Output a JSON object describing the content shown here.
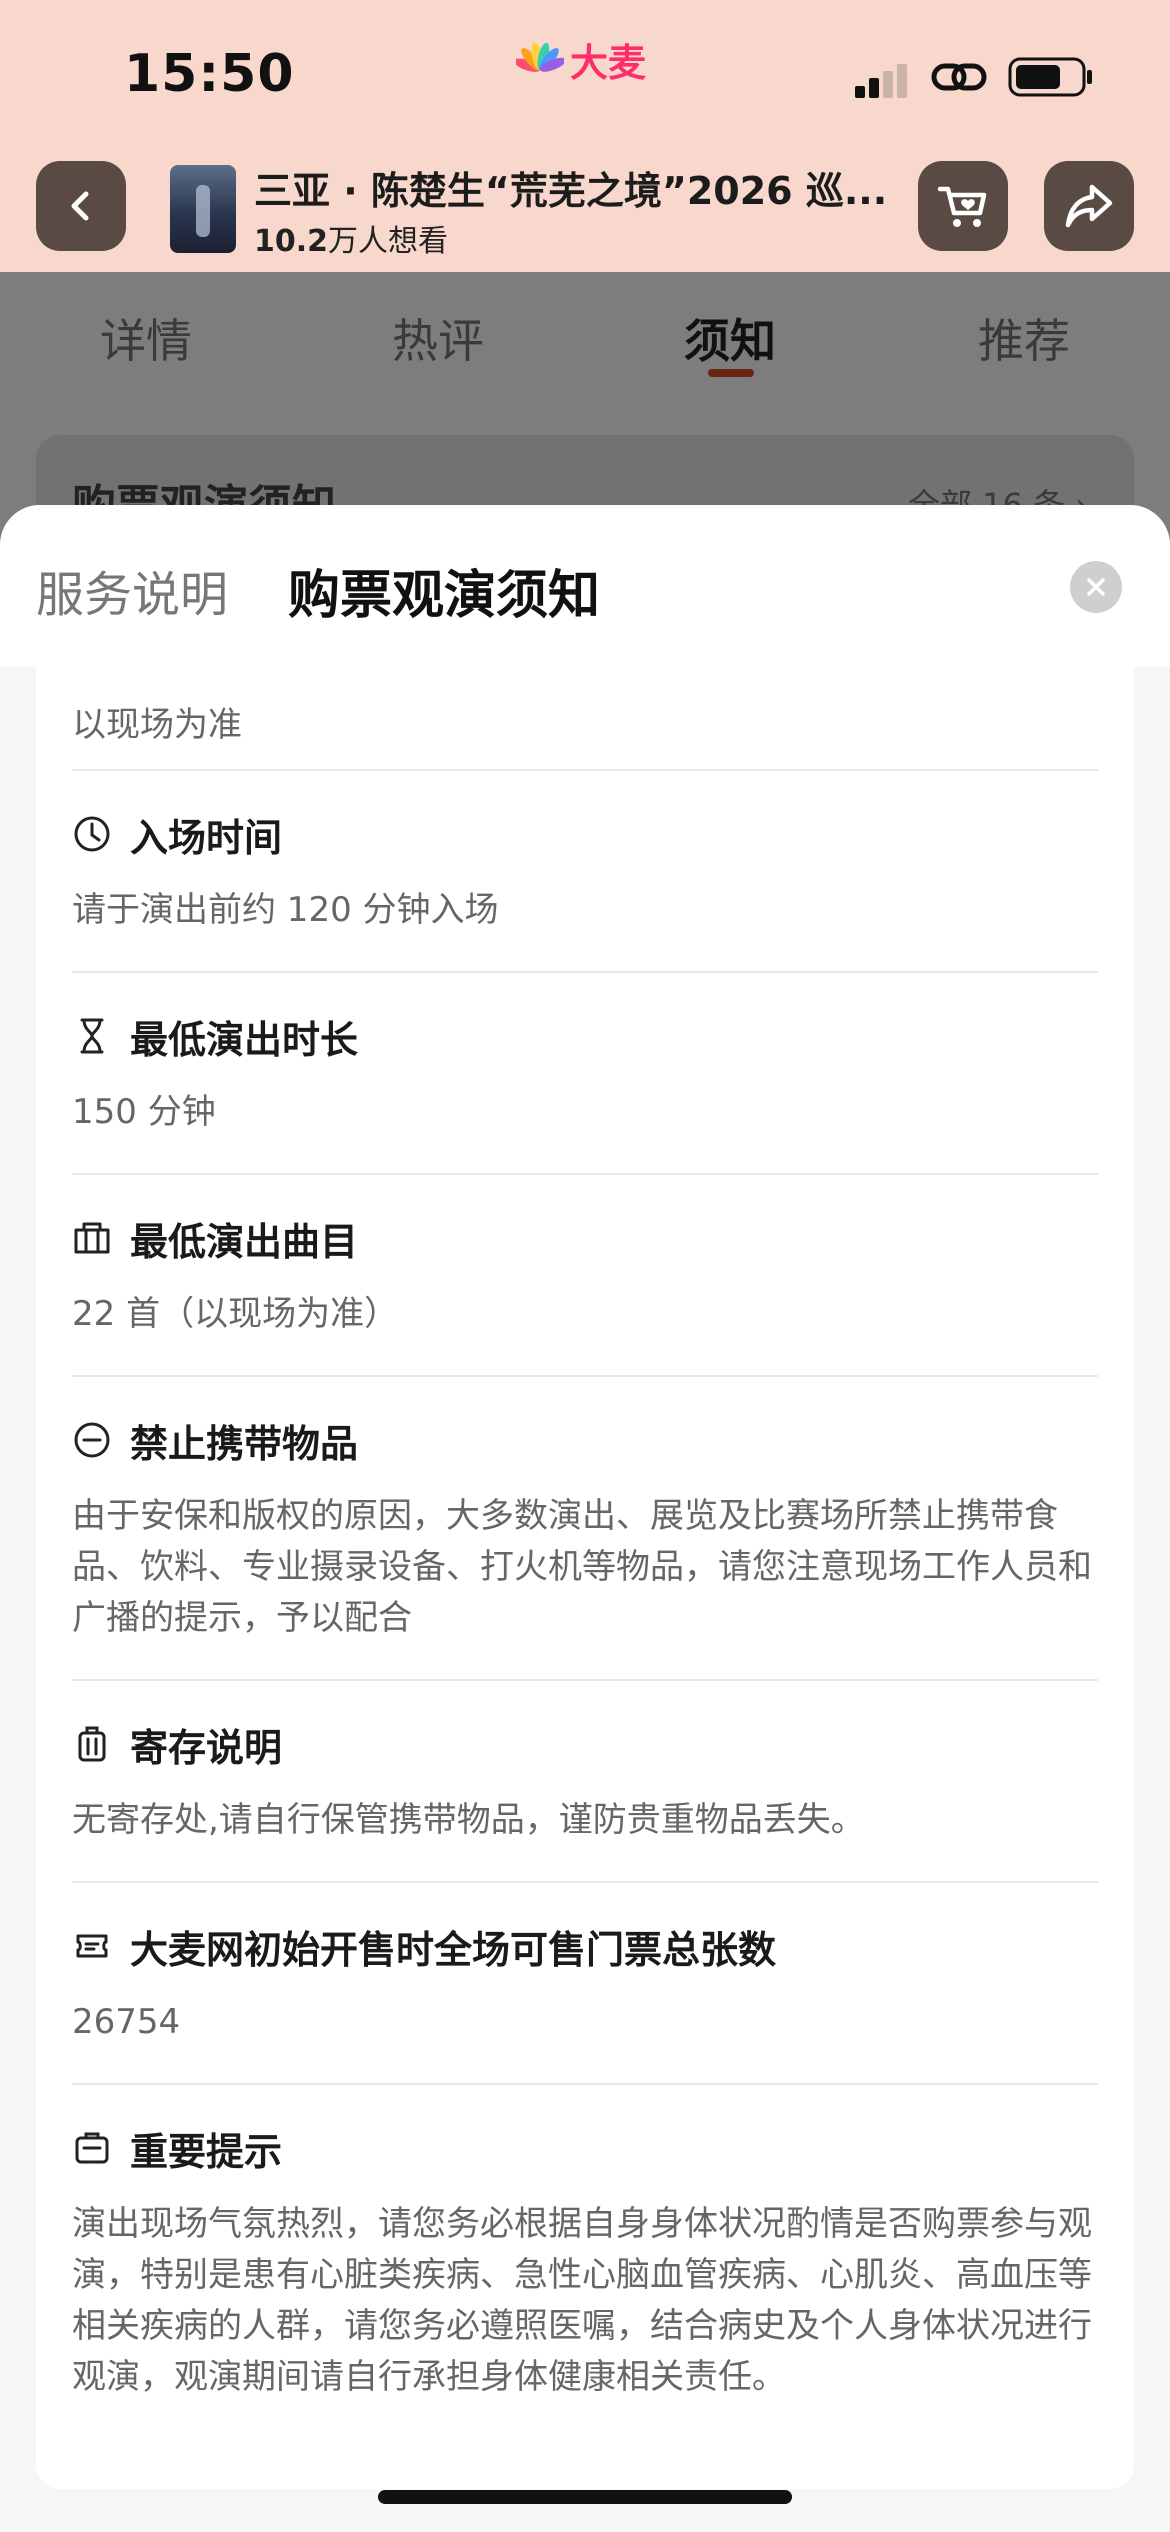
{
  "status_bar": {
    "time": "15:50",
    "brand": "大麦"
  },
  "header": {
    "title": "三亚 · 陈楚生“荒芜之境”2026 巡...",
    "want_count": "10.2",
    "want_suffix": "万人想看"
  },
  "tabs": [
    {
      "label": "详情"
    },
    {
      "label": "热评"
    },
    {
      "label": "须知"
    },
    {
      "label": "推荐"
    }
  ],
  "peek": {
    "title": "购票观演须知",
    "all": "全部 16 条 ›"
  },
  "sheet": {
    "tab_service": "服务说明",
    "tab_notice": "购票观演须知",
    "top_text": "以现场为准",
    "items": [
      {
        "icon": "clock-icon",
        "title": "入场时间",
        "body": "请于演出前约 120 分钟入场"
      },
      {
        "icon": "hourglass-icon",
        "title": "最低演出时长",
        "body": "150 分钟"
      },
      {
        "icon": "ticket-icon",
        "title": "最低演出曲目",
        "body": "22 首（以现场为准）"
      },
      {
        "icon": "prohibited-icon",
        "title": "禁止携带物品",
        "body": "由于安保和版权的原因，大多数演出、展览及比赛场所禁止携带食品、饮料、专业摄录设备、打火机等物品，请您注意现场工作人员和广播的提示，予以配合"
      },
      {
        "icon": "luggage-icon",
        "title": "寄存说明",
        "body": "无寄存处,请自行保管携带物品，谨防贵重物品丢失。"
      },
      {
        "icon": "tickets-icon",
        "title": "大麦网初始开售时全场可售门票总张数",
        "body": "26754"
      },
      {
        "icon": "clipboard-icon",
        "title": "重要提示",
        "body": "演出现场气氛热烈，请您务必根据自身身体状况酌情是否购票参与观演，特别是患有心脏类疾病、急性心脑血管疾病、心肌炎、高血压等相关疾病的人群，请您务必遵照医嘱，结合病史及个人身体状况进行观演，观演期间请自行承担身体健康相关责任。"
      }
    ]
  }
}
